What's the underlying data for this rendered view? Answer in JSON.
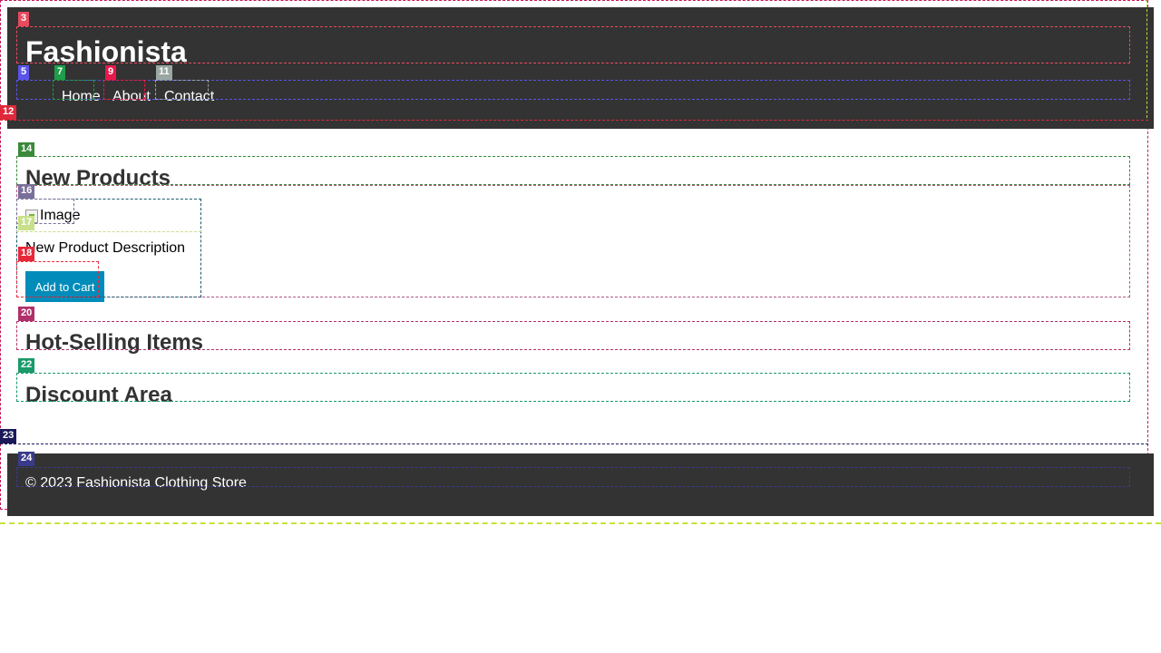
{
  "header": {
    "site_title": "Fashionista",
    "nav": [
      {
        "label": "Home"
      },
      {
        "label": "About"
      },
      {
        "label": "Contact"
      }
    ]
  },
  "main": {
    "new_products": {
      "heading": "New Products",
      "product": {
        "image_alt": "Image",
        "description": "New Product Description",
        "button_label": "Add to Cart"
      }
    },
    "hot_selling": {
      "heading": "Hot-Selling Items"
    },
    "discount": {
      "heading": "Discount Area"
    }
  },
  "footer": {
    "copyright": "© 2023 Fashionista Clothing Store"
  },
  "overlay_tags": [
    "3",
    "5",
    "7",
    "9",
    "11",
    "12",
    "14",
    "16",
    "17",
    "18",
    "20",
    "22",
    "23",
    "24"
  ],
  "colors": {
    "header_bg": "#333333",
    "button_bg": "#008CBA",
    "heading_text": "#333333"
  }
}
